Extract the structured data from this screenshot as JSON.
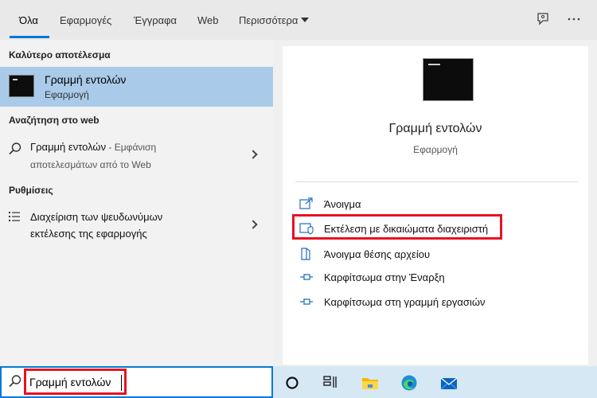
{
  "tabs": [
    {
      "label": "Όλα",
      "active": true
    },
    {
      "label": "Εφαρμογές"
    },
    {
      "label": "Έγγραφα"
    },
    {
      "label": "Web"
    },
    {
      "label": "Περισσότερα"
    }
  ],
  "top_icons": [
    "feedback-icon",
    "more-options-icon"
  ],
  "left": {
    "best_match_heading": "Καλύτερο αποτέλεσμα",
    "best_match": {
      "title": "Γραμμή εντολών",
      "subtitle": "Εφαρμογή"
    },
    "web_heading": "Αναζήτηση στο web",
    "web_result": {
      "query": "Γραμμή εντολών",
      "suffix": " - Εμφάνιση",
      "line2": "αποτελεσμάτων από το Web"
    },
    "settings_heading": "Ρυθμίσεις",
    "settings_result": {
      "line1": "Διαχείριση των ψευδωνύμων",
      "line2": "εκτέλεσης της εφαρμογής"
    }
  },
  "right": {
    "title": "Γραμμή εντολών",
    "subtitle": "Εφαρμογή",
    "actions": [
      {
        "label": "Άνοιγμα",
        "icon": "open-icon"
      },
      {
        "label": "Εκτέλεση με δικαιώματα διαχειριστή",
        "icon": "shield-icon"
      },
      {
        "label": "Άνοιγμα θέσης αρχείου",
        "icon": "file-location-icon"
      },
      {
        "label": "Καρφίτσωμα στην Έναρξη",
        "icon": "pin-icon"
      },
      {
        "label": "Καρφίτσωμα στη γραμμή εργασιών",
        "icon": "pin-icon"
      }
    ]
  },
  "taskbar": {
    "search_value": "Γραμμή εντολών",
    "icons": [
      "cortana-icon",
      "task-view-icon",
      "file-explorer-icon",
      "edge-icon",
      "mail-icon"
    ]
  },
  "colors": {
    "accent": "#0078d7",
    "highlight": "#e81123",
    "selection": "#a9cbe9"
  }
}
